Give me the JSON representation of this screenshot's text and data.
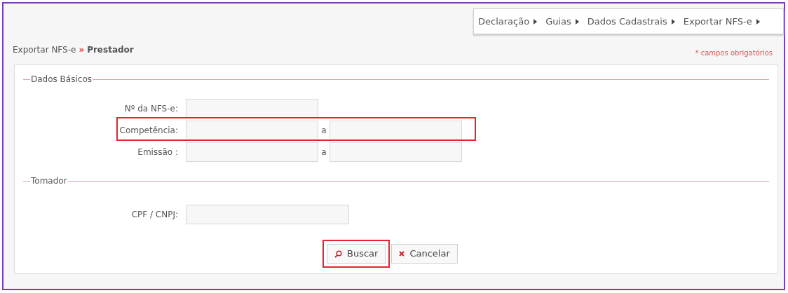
{
  "menu": [
    {
      "label": "Declaração"
    },
    {
      "label": "Guias"
    },
    {
      "label": "Dados Cadastrais"
    },
    {
      "label": "Exportar NFS-e"
    }
  ],
  "breadcrumb": {
    "parent": "Exportar NFS-e",
    "separator": "»",
    "current": "Prestador"
  },
  "required_note": "* campos obrigatórios",
  "sections": [
    {
      "legend": "Dados Básicos",
      "rows": [
        {
          "label": "Nº da NFS-e:",
          "kind": "single",
          "highlighted": false
        },
        {
          "label": "Competência:",
          "kind": "range",
          "connector": "a",
          "highlighted": true
        },
        {
          "label": "Emissão :",
          "kind": "range",
          "connector": "a",
          "highlighted": false
        }
      ]
    },
    {
      "legend": "Tomador",
      "rows": [
        {
          "label": "CPF / CNPJ:",
          "kind": "wide",
          "highlighted": false
        }
      ]
    }
  ],
  "buttons": [
    {
      "label": "Buscar",
      "kind": "search",
      "highlighted": true
    },
    {
      "label": "Cancelar",
      "kind": "cancel",
      "highlighted": false
    }
  ]
}
